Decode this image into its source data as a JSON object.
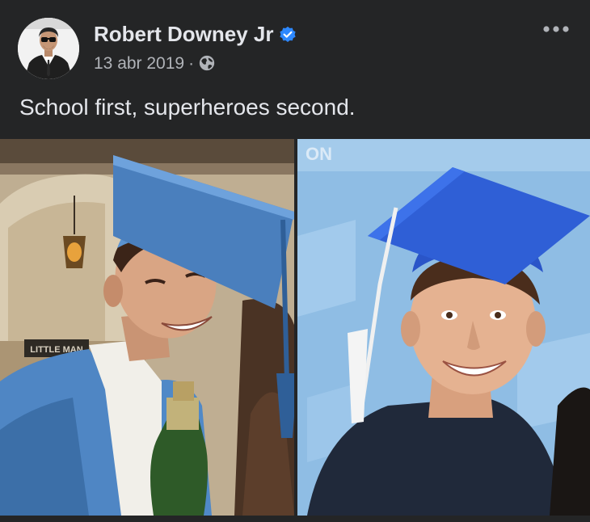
{
  "post": {
    "author": "Robert Downey Jr",
    "date": "13 abr 2019",
    "separator": "·",
    "caption": "School first, superheroes second.",
    "icons": {
      "avatar": "avatar",
      "verified": "verified-badge-icon",
      "privacy": "globe-icon",
      "more": "more-options-icon"
    },
    "colors": {
      "background": "#242526",
      "primary_text": "#e4e6eb",
      "secondary_text": "#b0b3b8",
      "verified": "#2d88ff"
    }
  },
  "image": {
    "left_panel": {
      "sign_text": "LITTLE MAN"
    },
    "right_panel": {
      "backdrop_text": "ON"
    }
  }
}
